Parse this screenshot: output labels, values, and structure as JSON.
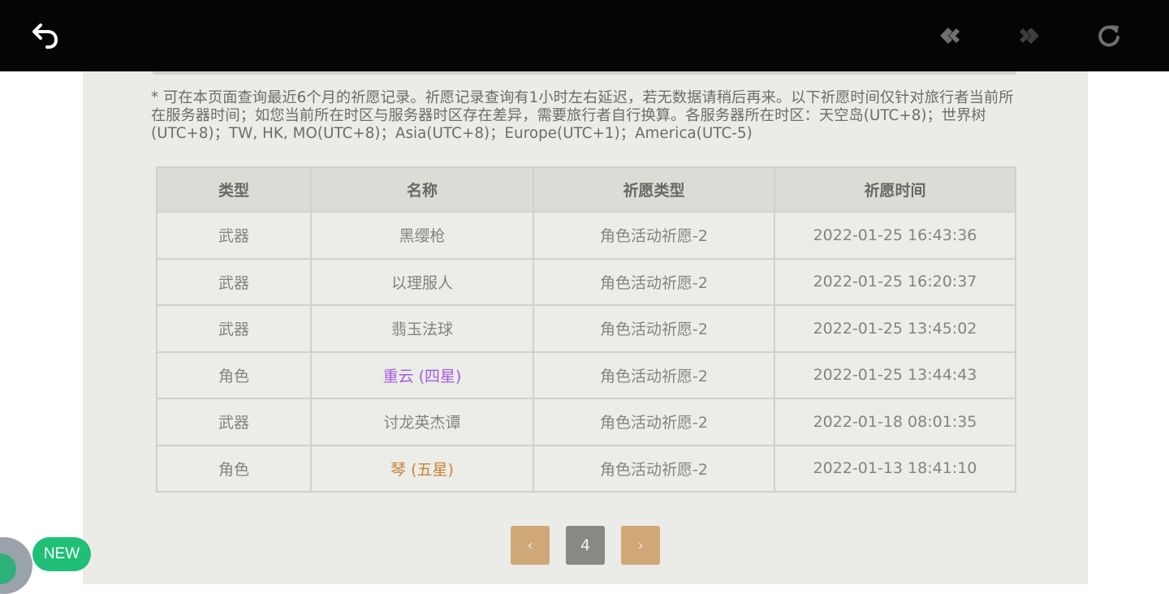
{
  "toolbar": {
    "back_icon": "back-arrow-icon",
    "prev_icon": "navigate-back-icon",
    "next_icon": "navigate-forward-icon",
    "refresh_icon": "refresh-icon"
  },
  "notice": "* 可在本页面查询最近6个月的祈愿记录。祈愿记录查询有1小时左右延迟，若无数据请稍后再来。以下祈愿时间仅针对旅行者当前所在服务器时间；如您当前所在时区与服务器时区存在差异，需要旅行者自行换算。各服务器所在时区：天空岛(UTC+8)；世界树(UTC+8)；TW, HK, MO(UTC+8)；Asia(UTC+8)；Europe(UTC+1)；America(UTC-5)",
  "table": {
    "headers": [
      "类型",
      "名称",
      "祈愿类型",
      "祈愿时间"
    ],
    "rows": [
      [
        "武器",
        "黑缨枪",
        "角色活动祈愿-2",
        "2022-01-25 16:43:36"
      ],
      [
        "武器",
        "以理服人",
        "角色活动祈愿-2",
        "2022-01-25 16:20:37"
      ],
      [
        "武器",
        "翡玉法球",
        "角色活动祈愿-2",
        "2022-01-25 13:45:02"
      ],
      [
        "角色",
        "重云 (四星)",
        "角色活动祈愿-2",
        "2022-01-25 13:44:43"
      ],
      [
        "武器",
        "讨龙英杰谭",
        "角色活动祈愿-2",
        "2022-01-18 08:01:35"
      ],
      [
        "角色",
        "琴 (五星)",
        "角色活动祈愿-2",
        "2022-01-13 18:41:10"
      ]
    ]
  },
  "colors": {
    "four_star": "#a45ce0",
    "five_star": "#c98238"
  },
  "pagination": {
    "prev_label": "‹",
    "current_page": "4",
    "next_label": "›"
  },
  "floating": {
    "new_badge": "NEW"
  }
}
